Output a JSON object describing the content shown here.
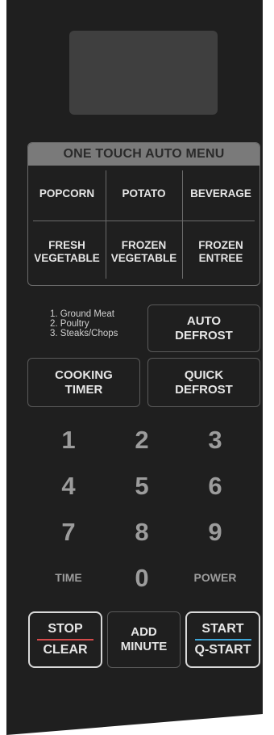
{
  "colors": {
    "panel": "#1f1f1f",
    "display": "#3f3f3f",
    "menu_header": "#7a7a7a",
    "stop_accent": "#d44b4b",
    "start_accent": "#3ea7d9"
  },
  "auto_menu": {
    "title": "ONE TOUCH AUTO MENU",
    "items": [
      "POPCORN",
      "POTATO",
      "BEVERAGE",
      "FRESH\nVEGETABLE",
      "FROZEN\nVEGETABLE",
      "FROZEN\nENTREE"
    ]
  },
  "defrost_options": [
    "1. Ground Meat",
    "2. Poultry",
    "3. Steaks/Chops"
  ],
  "buttons": {
    "auto_defrost": [
      "AUTO",
      "DEFROST"
    ],
    "cooking_timer": [
      "COOKING",
      "TIMER"
    ],
    "quick_defrost": [
      "QUICK",
      "DEFROST"
    ],
    "time": "TIME",
    "power": "POWER",
    "stop_clear": [
      "STOP",
      "CLEAR"
    ],
    "add_minute": [
      "ADD",
      "MINUTE"
    ],
    "start": [
      "START",
      "Q-START"
    ]
  },
  "keypad": [
    "1",
    "2",
    "3",
    "4",
    "5",
    "6",
    "7",
    "8",
    "9",
    "0"
  ]
}
